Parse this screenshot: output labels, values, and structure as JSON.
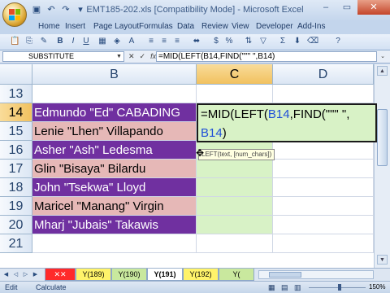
{
  "window": {
    "title": "EMT185-202.xls  [Compatibility Mode] - Microsoft Excel",
    "controls": [
      "–",
      "▭",
      "✕"
    ]
  },
  "ribbon": {
    "tabs": [
      "Home",
      "Insert",
      "Page Layout",
      "Formulas",
      "Data",
      "Review",
      "View",
      "Developer",
      "Add-Ins"
    ]
  },
  "formula_bar": {
    "name_box": "SUBSTITUTE",
    "fx_cancel": "✕",
    "fx_enter": "✓",
    "fx_label": "fx",
    "formula": "=MID(LEFT(B14,FIND(\"\"\" \",B14)"
  },
  "sheet": {
    "columns": [
      "B",
      "C",
      "D"
    ],
    "rows": [
      {
        "num": "13",
        "b": ""
      },
      {
        "num": "14",
        "b": "Edmundo \"Ed\" CABADING"
      },
      {
        "num": "15",
        "b": "Lenie \"Lhen\" Villapando"
      },
      {
        "num": "16",
        "b": "Asher \"Ash\" Ledesma"
      },
      {
        "num": "17",
        "b": "Glin \"Bisaya\" Bilardu"
      },
      {
        "num": "18",
        "b": "John \"Tsekwa\" Lloyd"
      },
      {
        "num": "19",
        "b": "Maricel \"Manang\" Virgin"
      },
      {
        "num": "20",
        "b": "Mharj \"Jubais\" Takawis"
      },
      {
        "num": "21",
        "b": ""
      }
    ],
    "editor": {
      "line1_a": "=MID(LEFT(",
      "line1_ref": "B14",
      "line1_b": ",FIND(\"\"\" \",",
      "line2_ref": "B14",
      "line2_b": ")"
    },
    "tooltip": "LEFT(text, [num_chars])"
  },
  "sheet_tabs": {
    "tabs": [
      "Y(189)",
      "Y(190)",
      "Y(191)",
      "Y(192)",
      "Y("
    ],
    "active": "Y(191)"
  },
  "status_bar": {
    "mode": "Edit",
    "calc": "Calculate",
    "zoom": "150%"
  },
  "colors": {
    "purple_fill": "#7030a0",
    "pink_fill": "#e6b8b7",
    "green_fill": "#d8f2c6",
    "ref_blue": "#1f4fd8"
  }
}
